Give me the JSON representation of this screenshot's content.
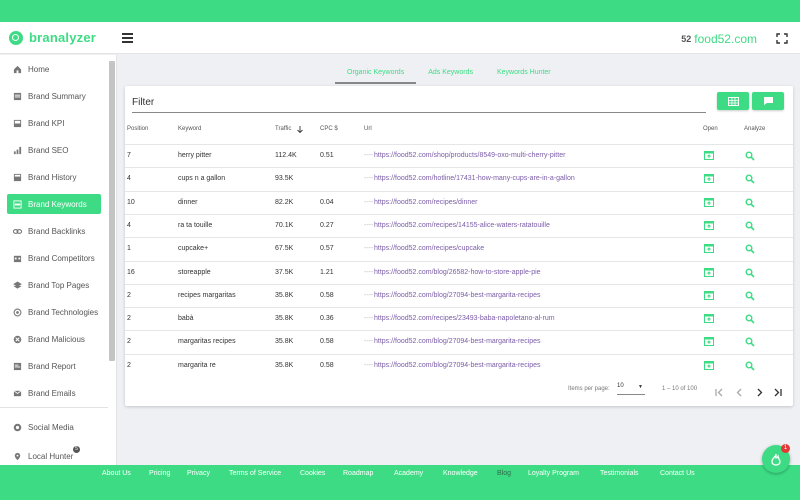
{
  "app": {
    "logo_text": "branalyzer",
    "brand_mark": "52",
    "brand_domain": "food52.com"
  },
  "colors": {
    "accent": "#3ddc84",
    "url": "#7b5da8"
  },
  "sidebar": {
    "items": [
      {
        "label": "Home",
        "icon": "home-icon"
      },
      {
        "label": "Brand Summary",
        "icon": "summary-icon"
      },
      {
        "label": "Brand KPI",
        "icon": "kpi-icon"
      },
      {
        "label": "Brand SEO",
        "icon": "seo-icon"
      },
      {
        "label": "Brand History",
        "icon": "history-icon"
      },
      {
        "label": "Brand Keywords",
        "icon": "keywords-icon",
        "active": true
      },
      {
        "label": "Brand Backlinks",
        "icon": "link-icon"
      },
      {
        "label": "Brand Competitors",
        "icon": "competitors-icon"
      },
      {
        "label": "Brand Top Pages",
        "icon": "layers-icon"
      },
      {
        "label": "Brand Technologies",
        "icon": "tech-icon"
      },
      {
        "label": "Brand Malicious",
        "icon": "malicious-icon"
      },
      {
        "label": "Brand Report",
        "icon": "report-icon"
      },
      {
        "label": "Brand Emails",
        "icon": "mail-icon"
      },
      {
        "label": "Social Media",
        "icon": "social-icon"
      },
      {
        "label": "Local Hunter",
        "icon": "pin-icon"
      }
    ]
  },
  "tabs": [
    "Organic Keywords",
    "Ads Keywords",
    "Keywords Hunter"
  ],
  "filter": {
    "label": "Filter"
  },
  "table": {
    "headers": {
      "position": "Position",
      "keyword": "Keyword",
      "traffic": "Traffic",
      "cpc": "CPC $",
      "url": "Url",
      "open": "Open",
      "analyze": "Analyze"
    },
    "url_prefix": "----",
    "rows": [
      {
        "position": "7",
        "keyword": "herry pitter",
        "traffic": "112.4K",
        "cpc": "0.51",
        "url": "https://food52.com/shop/products/8549-oxo-multi-cherry-pitter"
      },
      {
        "position": "4",
        "keyword": "cups n a gallon",
        "traffic": "93.5K",
        "cpc": "",
        "url": "https://food52.com/hotline/17431-how-many-cups-are-in-a-gallon"
      },
      {
        "position": "10",
        "keyword": "dinner",
        "traffic": "82.2K",
        "cpc": "0.04",
        "url": "https://food52.com/recipes/dinner"
      },
      {
        "position": "4",
        "keyword": "ra ta touille",
        "traffic": "70.1K",
        "cpc": "0.27",
        "url": "https://food52.com/recipes/14155-alice-waters-ratatouille"
      },
      {
        "position": "1",
        "keyword": "cupcake+",
        "traffic": "67.5K",
        "cpc": "0.57",
        "url": "https://food52.com/recipes/cupcake"
      },
      {
        "position": "16",
        "keyword": "storeapple",
        "traffic": "37.5K",
        "cpc": "1.21",
        "url": "https://food52.com/blog/26582-how-to-store-apple-pie"
      },
      {
        "position": "2",
        "keyword": "recipes margaritas",
        "traffic": "35.8K",
        "cpc": "0.58",
        "url": "https://food52.com/blog/27094-best-margarita-recipes"
      },
      {
        "position": "2",
        "keyword": "babà",
        "traffic": "35.8K",
        "cpc": "0.36",
        "url": "https://food52.com/recipes/23493-baba-napoletano-al-rum"
      },
      {
        "position": "2",
        "keyword": "margaritas recipes",
        "traffic": "35.8K",
        "cpc": "0.58",
        "url": "https://food52.com/blog/27094-best-margarita-recipes"
      },
      {
        "position": "2",
        "keyword": "margarita re",
        "traffic": "35.8K",
        "cpc": "0.58",
        "url": "https://food52.com/blog/27094-best-margarita-recipes"
      }
    ]
  },
  "pagination": {
    "items_per_page_label": "Items per page:",
    "items_per_page": "10",
    "range": "1 – 10 of 100"
  },
  "footer": {
    "links": [
      "About Us",
      "Pricing",
      "Privacy",
      "Terms of Service",
      "Cookies",
      "Roadmap",
      "Academy",
      "Knowledge",
      "Blog",
      "Loyalty Program",
      "Testimonials",
      "Contact Us"
    ],
    "current": "Blog"
  },
  "fab": {
    "badge": "1"
  },
  "local_hunter_badge": "5"
}
